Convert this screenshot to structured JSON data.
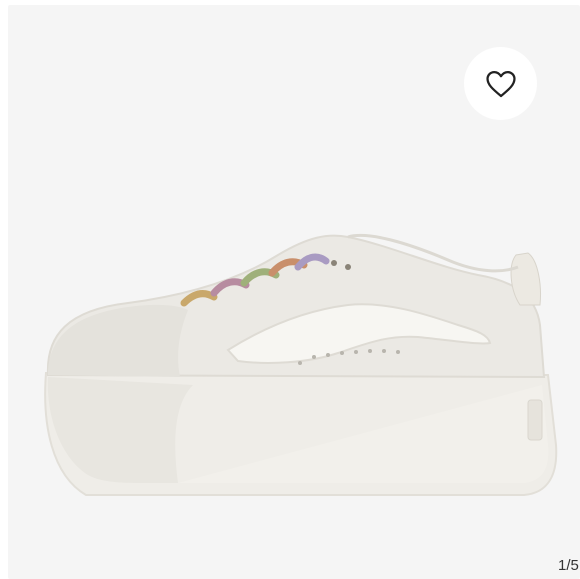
{
  "gallery": {
    "image_subject": "white-platform-sneaker",
    "favorite_icon": "heart-outline-icon",
    "page_indicator": "1/5",
    "colors": {
      "background": "#f5f5f5",
      "button_bg": "#ffffff",
      "icon": "#222222",
      "text": "#333333"
    }
  }
}
